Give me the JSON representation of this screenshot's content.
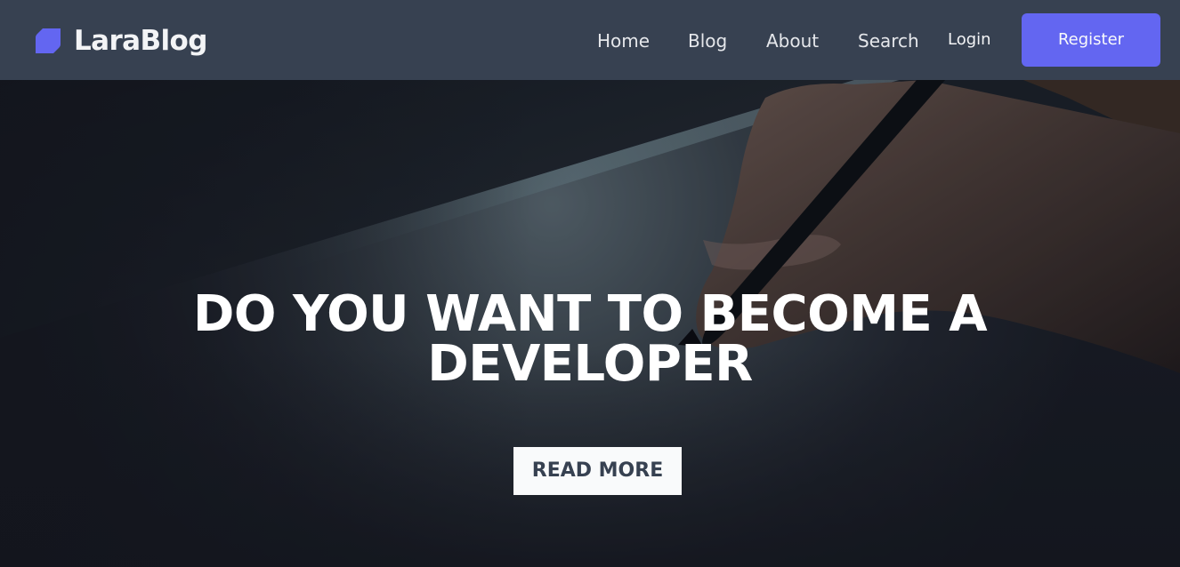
{
  "navbar": {
    "brand": {
      "name": "LaraBlog",
      "icon": "brand-logo-icon"
    },
    "links": {
      "home": "Home",
      "blog": "Blog",
      "about": "About",
      "search": "Search",
      "login": "Login"
    },
    "register_label": "Register"
  },
  "hero": {
    "title": "DO YOU WANT TO BECOME A DEVELOPER",
    "cta_label": "READ MORE",
    "image": "hand-writing-with-pen-photo"
  },
  "colors": {
    "navbar_bg": "#374151",
    "accent": "#6366f1",
    "hero_text": "#ffffff",
    "cta_bg": "#f9fafb",
    "cta_text": "#374151"
  }
}
